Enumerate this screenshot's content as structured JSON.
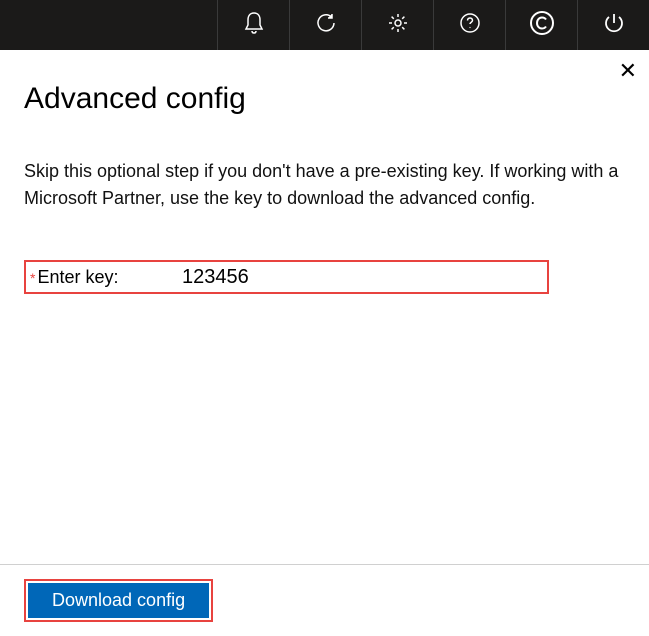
{
  "topbar": {
    "icons": [
      "bell",
      "refresh",
      "settings",
      "help",
      "copyright",
      "power"
    ]
  },
  "dialog": {
    "title": "Advanced config",
    "description": "Skip this optional step if you don't have a pre-existing key. If working with a Microsoft Partner, use the key to download the advanced config.",
    "field": {
      "required_marker": "*",
      "label": "Enter key:",
      "value": "123456"
    },
    "download_label": "Download config",
    "close_label": "✕"
  }
}
